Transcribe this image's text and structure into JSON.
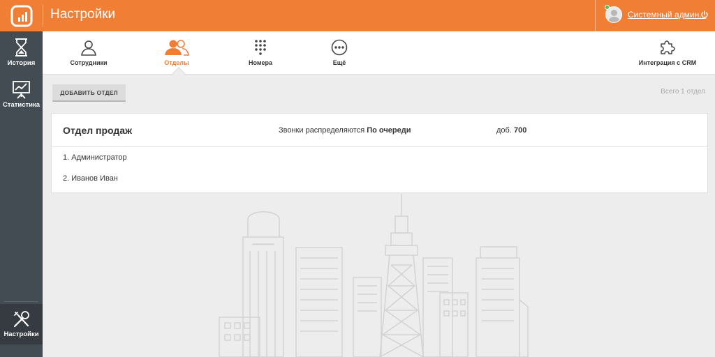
{
  "header": {
    "title": "Настройки",
    "user_name": "Системный админ...",
    "icons": {
      "logo": "logo-icon",
      "power": "power-icon"
    },
    "colors": {
      "accent": "#f07f35",
      "online": "#4fc04a"
    }
  },
  "sidebar": {
    "items": [
      {
        "label": "История",
        "icon": "hourglass-icon"
      },
      {
        "label": "Статистика",
        "icon": "chart-board-icon"
      }
    ],
    "bottom": {
      "label": "Настройки",
      "icon": "tools-icon"
    }
  },
  "tabs": [
    {
      "label": "Сотрудники",
      "icon": "user-icon"
    },
    {
      "label": "Отделы",
      "icon": "users-icon",
      "active": true
    },
    {
      "label": "Номера",
      "icon": "keypad-icon"
    },
    {
      "label": "Ещё",
      "icon": "more-icon"
    },
    {
      "label": "Интеграция с CRM",
      "icon": "puzzle-icon"
    }
  ],
  "actions": {
    "add_department": "ДОБАВИТЬ ОТДЕЛ",
    "total": "Всего 1 отдел"
  },
  "department": {
    "name": "Отдел продаж",
    "distribution_prefix": "Звонки распределяются",
    "distribution_mode": "По очереди",
    "ext_prefix": "доб.",
    "ext_number": "700",
    "members": [
      "1. Администратор",
      "2. Иванов Иван"
    ]
  }
}
